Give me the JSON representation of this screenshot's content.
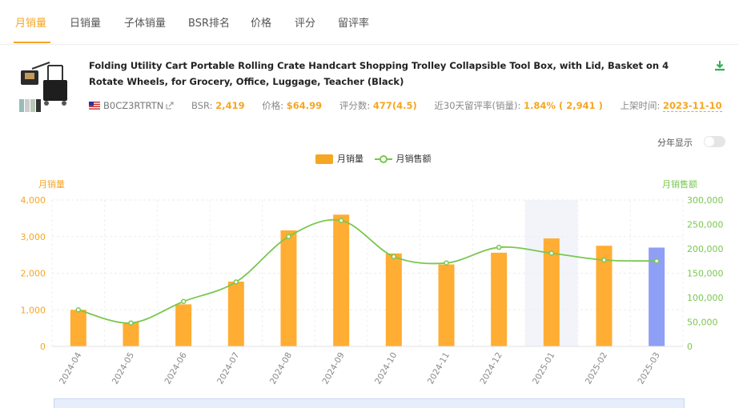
{
  "tabs": [
    {
      "label": "月销量",
      "active": true
    },
    {
      "label": "日销量",
      "active": false
    },
    {
      "label": "子体销量",
      "active": false
    },
    {
      "label": "BSR排名",
      "active": false
    },
    {
      "label": "价格",
      "active": false
    },
    {
      "label": "评分",
      "active": false
    },
    {
      "label": "留评率",
      "active": false
    }
  ],
  "product": {
    "title": "Folding Utility Cart Portable Rolling Crate Handcart Shopping Trolley Collapsible Tool Box, with Lid, Basket on 4 Rotate Wheels, for Grocery, Office, Luggage, Teacher (Black)",
    "asin": "B0CZ3RTRTN",
    "bsr_label": "BSR:",
    "bsr_value": "2,419",
    "price_label": "价格:",
    "price_value": "$64.99",
    "reviews_label": "评分数:",
    "reviews_value": "477(4.5)",
    "review_rate_label": "近30天留评率(销量):",
    "review_rate_value": "1.84% ( 2,941 )",
    "listed_label": "上架时间:",
    "listed_value": "2023-11-10"
  },
  "controls": {
    "year_toggle_label": "分年显示",
    "year_toggle_on": false
  },
  "colors": {
    "accent": "#f5a623",
    "bar": "#ffad33",
    "bar_current": "#8f9ff5",
    "line": "#7ac74f",
    "highlight_band": "#f2f4fa"
  },
  "chart_data": {
    "type": "bar",
    "categories": [
      "2024-04",
      "2024-05",
      "2024-06",
      "2024-07",
      "2024-08",
      "2024-09",
      "2024-10",
      "2024-11",
      "2024-12",
      "2025-01",
      "2025-02",
      "2025-03"
    ],
    "series": [
      {
        "name": "月销量",
        "type": "bar",
        "axis": "left",
        "values": [
          1000,
          650,
          1150,
          1770,
          3170,
          3600,
          2540,
          2240,
          2560,
          2950,
          2750,
          2700
        ]
      },
      {
        "name": "月销售额",
        "type": "line",
        "axis": "right",
        "values": [
          75000,
          48000,
          92000,
          132000,
          225000,
          258000,
          184000,
          171000,
          203000,
          191000,
          177000,
          175000
        ]
      }
    ],
    "ylabel_left": "月销量",
    "ylabel_right": "月销售额",
    "ylim_left": [
      0,
      4000
    ],
    "yticks_left": [
      "0",
      "1,000",
      "2,000",
      "3,000",
      "4,000"
    ],
    "ylim_right": [
      0,
      300000
    ],
    "yticks_right": [
      "0",
      "50,000",
      "100,000",
      "150,000",
      "200,000",
      "250,000",
      "300,000"
    ],
    "highlight_category": "2025-01",
    "grid": true,
    "legend": "top-center"
  }
}
